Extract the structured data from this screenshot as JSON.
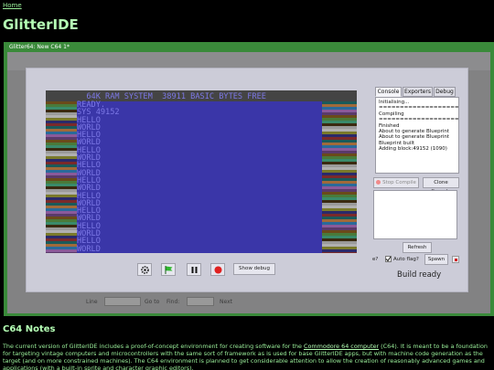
{
  "nav": {
    "home_link": "Home"
  },
  "page": {
    "title": "GlitterIDE"
  },
  "window": {
    "title": "Glitter64: New C64 1*"
  },
  "ghost": {
    "line_label": "Line",
    "goto_label": "Go to",
    "find_label": "Find:",
    "next_label": "Next"
  },
  "c64_screen": {
    "header": "  64K RAM SYSTEM  38911 BASIC BYTES FREE",
    "lines": [
      "READY.",
      "SYS 49152",
      "HELLO",
      "WORLD",
      "HELLO",
      "WORLD",
      "HELLO",
      "WORLD",
      "HELLO",
      "WORLD",
      "HELLO",
      "WORLD",
      "HELLO",
      "WORLD",
      "HELLO",
      "WORLD",
      "HELLO",
      "WORLD",
      "HELLO",
      "WORLD"
    ],
    "colors": {
      "border": "#444444",
      "background": "#3a36a8",
      "text": "#7c78e6"
    }
  },
  "emulator_controls": {
    "show_debug_label": "Show debug"
  },
  "tabs": [
    {
      "label": "Console",
      "active": true
    },
    {
      "label": "Exporters",
      "active": false
    },
    {
      "label": "Debug",
      "active": false
    }
  ],
  "console_lines": [
    "Initialising...",
    "===================",
    "Compiling",
    "===================",
    "Finished",
    "About to generate Blueprint",
    "About to generate Blueprint",
    "Blueprint built",
    "Adding block:49152 (1090)"
  ],
  "buttons": {
    "stop_compile": "Stop Compile",
    "clone_console": "Clone Console",
    "refresh": "Refresh",
    "spawn": "Spawn"
  },
  "auto_flag": {
    "partial_label": "e?",
    "label": "Auto flag?",
    "checked": true
  },
  "status": {
    "build": "Build ready"
  },
  "notes": {
    "title": "C64 Notes",
    "text_before_link": "The current version of GlitterIDE includes a proof-of-concept environment for creating software for the ",
    "link_text": "Commodore 64 computer",
    "text_after_link": " (C64). It is meant to be a foundation for targeting vintage computers and microcontrollers with the same sort of framework as is used for base GlitterIDE apps, but with machine code generation as the target (and on more constrained machines). The C64 environment is planned to get considerable attention to allow the creation of reasonably advanced games and applications (with a built-in sprite and character graphic editors)."
  },
  "colors": {
    "page_bg": "#000000",
    "text": "#9bf09b",
    "window_frame": "#3a8a3a",
    "modal_bg": "#ccccd8"
  }
}
